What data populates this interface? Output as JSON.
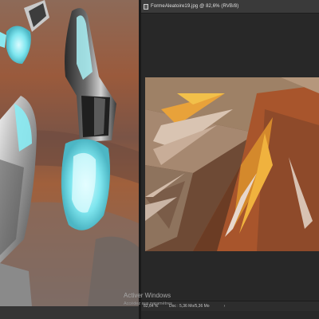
{
  "left_document": {
    "description_icon": "painting-canvas"
  },
  "right_panel": {
    "tab": {
      "title": "FormeAleatoire19.jpg @ 82,6% (RVB/8)",
      "icon": "document-icon"
    },
    "status": {
      "zoom": "82,64 %",
      "doc_info": "Doc : 5,36 Mo/5,36 Mo",
      "arrow": "›"
    }
  },
  "watermark": {
    "line1": "Activer Windows",
    "line2": "Accédez aux paramètres"
  },
  "colors": {
    "app_bg": "#282828",
    "panel_header": "#3a3a3a",
    "accent_orange": "#e8a23a",
    "rust": "#a8552c",
    "taupe": "#9a7d62",
    "ice_blue": "#7fe6ef"
  }
}
